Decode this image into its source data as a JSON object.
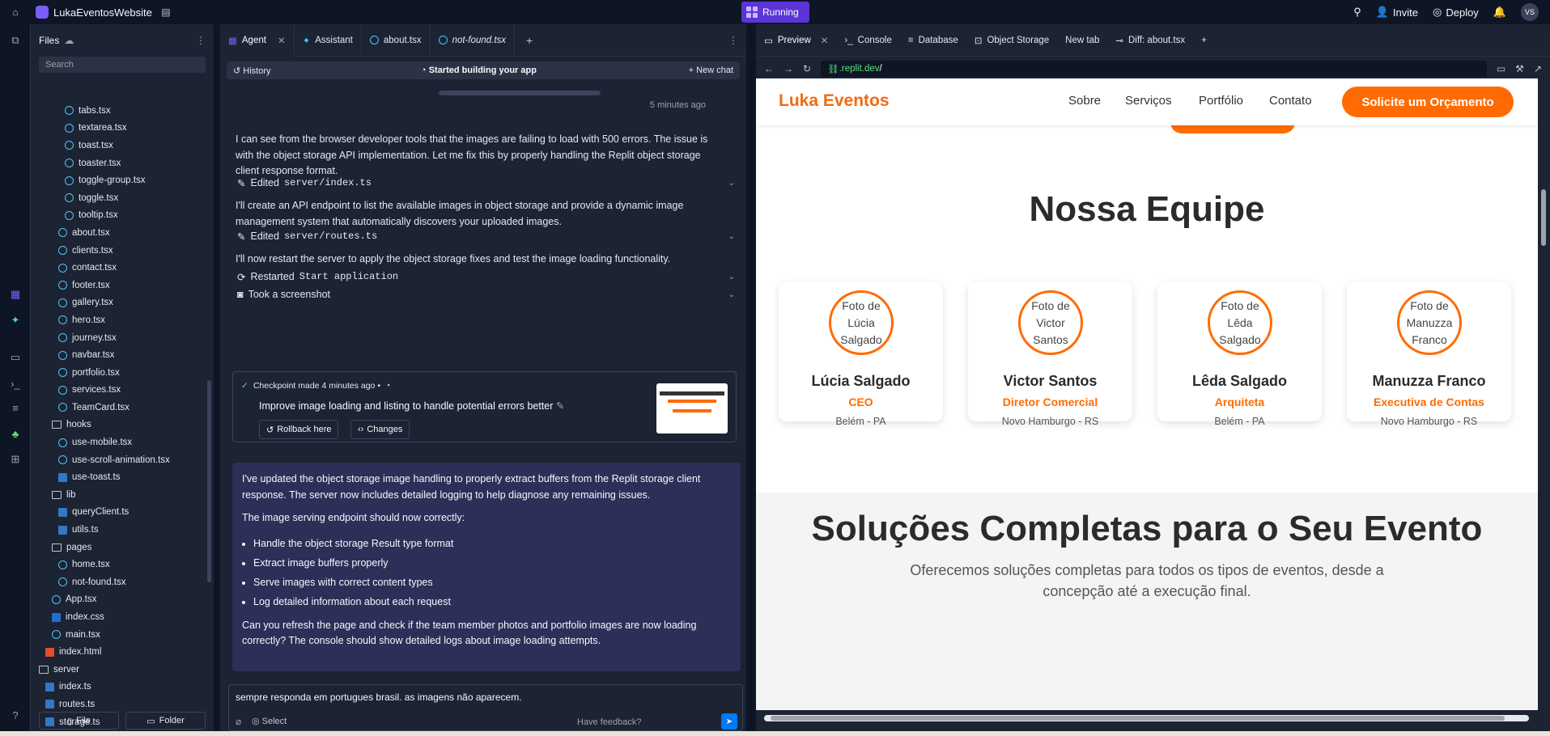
{
  "topbar": {
    "app_name": "LukaEventosWebsite",
    "running_label": "Running",
    "invite_label": "Invite",
    "deploy_label": "Deploy",
    "avatar_initials": "VS"
  },
  "files": {
    "title": "Files",
    "search_placeholder": "Search",
    "tree": [
      {
        "name": "tabs.tsx",
        "type": "react",
        "indent": 3
      },
      {
        "name": "textarea.tsx",
        "type": "react",
        "indent": 3
      },
      {
        "name": "toast.tsx",
        "type": "react",
        "indent": 3
      },
      {
        "name": "toaster.tsx",
        "type": "react",
        "indent": 3
      },
      {
        "name": "toggle-group.tsx",
        "type": "react",
        "indent": 3
      },
      {
        "name": "toggle.tsx",
        "type": "react",
        "indent": 3
      },
      {
        "name": "tooltip.tsx",
        "type": "react",
        "indent": 3
      },
      {
        "name": "about.tsx",
        "type": "react",
        "indent": 2
      },
      {
        "name": "clients.tsx",
        "type": "react",
        "indent": 2
      },
      {
        "name": "contact.tsx",
        "type": "react",
        "indent": 2
      },
      {
        "name": "footer.tsx",
        "type": "react",
        "indent": 2
      },
      {
        "name": "gallery.tsx",
        "type": "react",
        "indent": 2
      },
      {
        "name": "hero.tsx",
        "type": "react",
        "indent": 2
      },
      {
        "name": "journey.tsx",
        "type": "react",
        "indent": 2
      },
      {
        "name": "navbar.tsx",
        "type": "react",
        "indent": 2
      },
      {
        "name": "portfolio.tsx",
        "type": "react",
        "indent": 2
      },
      {
        "name": "services.tsx",
        "type": "react",
        "indent": 2
      },
      {
        "name": "TeamCard.tsx",
        "type": "react",
        "indent": 2
      },
      {
        "name": "hooks",
        "type": "folder",
        "indent": 1
      },
      {
        "name": "use-mobile.tsx",
        "type": "react",
        "indent": 2
      },
      {
        "name": "use-scroll-animation.tsx",
        "type": "react",
        "indent": 2
      },
      {
        "name": "use-toast.ts",
        "type": "ts",
        "indent": 2
      },
      {
        "name": "lib",
        "type": "folder",
        "indent": 1
      },
      {
        "name": "queryClient.ts",
        "type": "ts",
        "indent": 2
      },
      {
        "name": "utils.ts",
        "type": "ts",
        "indent": 2
      },
      {
        "name": "pages",
        "type": "folder",
        "indent": 1
      },
      {
        "name": "home.tsx",
        "type": "react",
        "indent": 2
      },
      {
        "name": "not-found.tsx",
        "type": "react",
        "indent": 2
      },
      {
        "name": "App.tsx",
        "type": "react",
        "indent": 1
      },
      {
        "name": "index.css",
        "type": "css",
        "indent": 1
      },
      {
        "name": "main.tsx",
        "type": "react",
        "indent": 1
      },
      {
        "name": "index.html",
        "type": "html",
        "indent": 0
      },
      {
        "name": "server",
        "type": "folder",
        "indent": -1
      },
      {
        "name": "index.ts",
        "type": "ts",
        "indent": 0
      },
      {
        "name": "routes.ts",
        "type": "ts",
        "indent": 0
      },
      {
        "name": "storage.ts",
        "type": "ts",
        "indent": 0
      }
    ],
    "file_button": "File",
    "folder_button": "Folder"
  },
  "agent": {
    "tabs": [
      "Agent",
      "Assistant",
      "about.tsx",
      "not-found.tsx"
    ],
    "history_label": "History",
    "started_label": "Started building your app",
    "new_chat_label": "New chat",
    "timestamp": "5 minutes ago",
    "msg1": "I can see from the browser developer tools that the images are failing to load with 500 errors. The issue is with the object storage API implementation. Let me fix this by properly handling the Replit object storage client response format.",
    "edit1_prefix": "Edited",
    "edit1_file": "server/index.ts",
    "msg2": "I'll create an API endpoint to list the available images in object storage and provide a dynamic image management system that automatically discovers your uploaded images.",
    "edit2_prefix": "Edited",
    "edit2_file": "server/routes.ts",
    "msg3": "I'll now restart the server to apply the object storage fixes and test the image loading functionality.",
    "restart_prefix": "Restarted",
    "restart_target": "Start application",
    "screenshot_label": "Took a screenshot",
    "checkpoint_label": "Checkpoint made 4 minutes ago •",
    "checkpoint_desc": "Improve image loading and listing to handle potential errors better",
    "rollback_label": "Rollback here",
    "changes_label": "Changes",
    "reply_p1": "I've updated the object storage image handling to properly extract buffers from the Replit storage client response. The server now includes detailed logging to help diagnose any remaining issues.",
    "reply_p2": "The image serving endpoint should now correctly:",
    "reply_bullets": [
      "Handle the object storage Result type format",
      "Extract image buffers properly",
      "Serve images with correct content types",
      "Log detailed information about each request"
    ],
    "reply_p3": "Can you refresh the page and check if the team member photos and portfolio images are now loading correctly? The console should show detailed logs about image loading attempts.",
    "input_text": "sempre responda em portugues brasil. as imagens não aparecem.",
    "select_label": "Select",
    "feedback_label": "Have feedback?"
  },
  "preview": {
    "tabs": [
      "Preview",
      "Console",
      "Database",
      "Object Storage",
      "New tab",
      "Diff: about.tsx"
    ],
    "url_domain": ".replit.dev",
    "url_path": "/",
    "site": {
      "brand": "Luka Eventos",
      "nav": [
        "Sobre",
        "Serviços",
        "Portfólio",
        "Contato"
      ],
      "cta": "Solicite um Orçamento",
      "team_title": "Nossa Equipe",
      "team": [
        {
          "photo_alt": "Foto de Lúcia Salgado",
          "name": "Lúcia Salgado",
          "role": "CEO",
          "location": "Belém - PA"
        },
        {
          "photo_alt": "Foto de Victor Santos",
          "name": "Victor Santos",
          "role": "Diretor Comercial",
          "location": "Novo Hamburgo - RS"
        },
        {
          "photo_alt": "Foto de Lêda Salgado",
          "name": "Lêda Salgado",
          "role": "Arquiteta",
          "location": "Belém - PA"
        },
        {
          "photo_alt": "Foto de Manuzza Franco",
          "name": "Manuzza Franco",
          "role": "Executiva de Contas",
          "location": "Novo Hamburgo - RS"
        }
      ],
      "solutions_title": "Soluções Completas para o Seu Evento",
      "solutions_sub": "Oferecemos soluções completas para todos os tipos de eventos, desde a concepção até a execução final."
    }
  },
  "colors": {
    "accent": "#ff6b00",
    "running": "#5b35d5",
    "reply_bg": "#2c2f57"
  }
}
